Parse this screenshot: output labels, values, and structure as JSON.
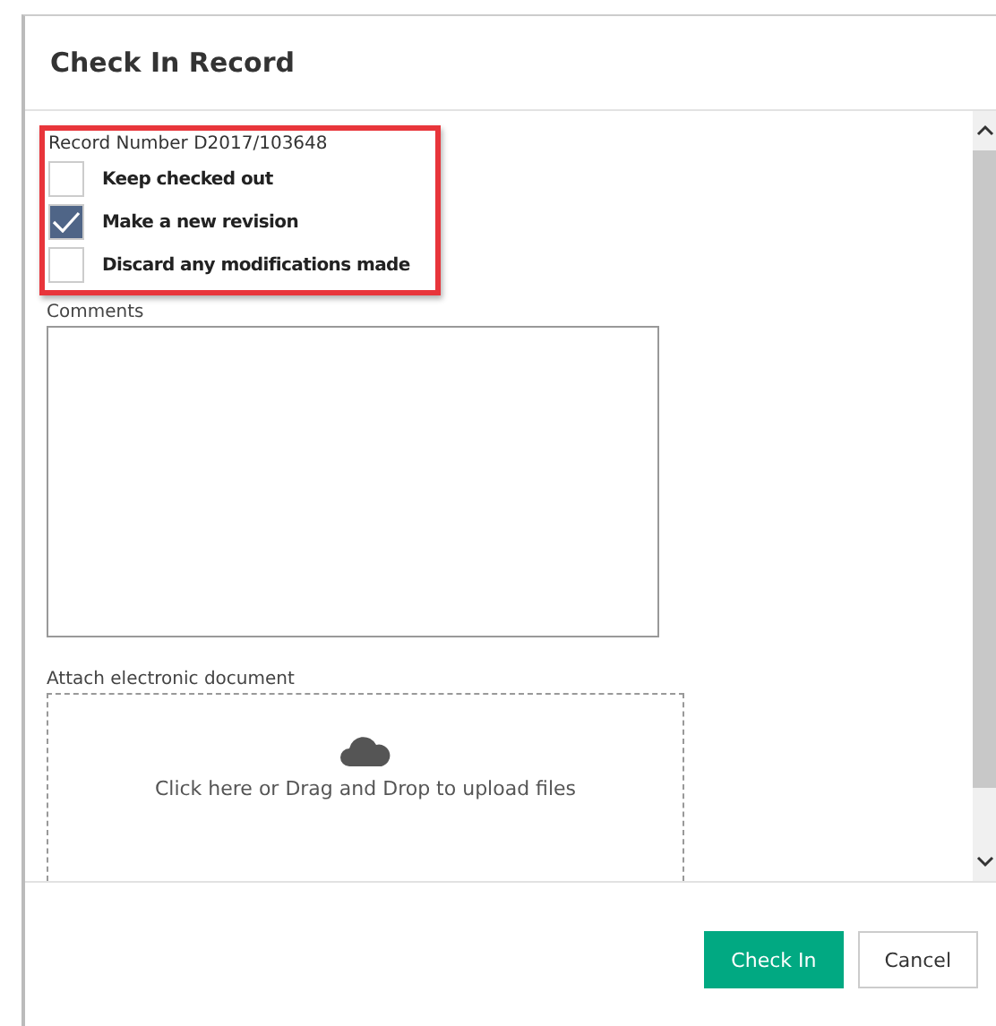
{
  "dialog": {
    "title": "Check In Record"
  },
  "record_number": "Record Number D2017/103648",
  "options": [
    {
      "label": "Keep checked out",
      "checked": false
    },
    {
      "label": "Make a new revision",
      "checked": true
    },
    {
      "label": "Discard any modifications made",
      "checked": false
    }
  ],
  "comments": {
    "label": "Comments"
  },
  "attach": {
    "label": "Attach electronic document",
    "drop_text": "Click here or Drag and Drop to upload files"
  },
  "buttons": [
    {
      "label": "Check In",
      "kind": "primary"
    },
    {
      "label": "Cancel",
      "kind": "secondary"
    }
  ]
}
